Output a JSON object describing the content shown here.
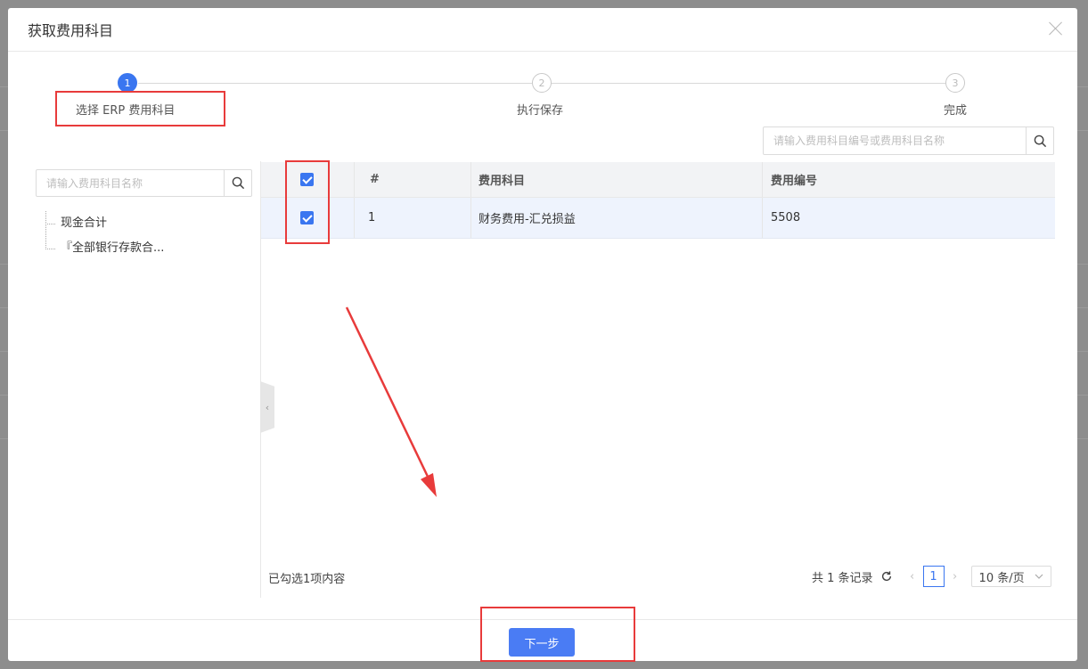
{
  "modal": {
    "title": "获取费用科目"
  },
  "steps": [
    {
      "number": "1",
      "label": "选择 ERP 费用科目",
      "state": "active"
    },
    {
      "number": "2",
      "label": "执行保存",
      "state": "idle"
    },
    {
      "number": "3",
      "label": "完成",
      "state": "idle"
    }
  ],
  "search": {
    "table_placeholder": "请输入费用科目编号或费用科目名称",
    "tree_placeholder": "请输入费用科目名称"
  },
  "tree": {
    "items": [
      "现金合计",
      "『全部银行存款合..."
    ]
  },
  "table": {
    "headers": {
      "index": "#",
      "account": "费用科目",
      "code": "费用编号"
    },
    "rows": [
      {
        "index": "1",
        "account": "财务费用-汇兑损益",
        "code": "5508",
        "checked": true
      }
    ]
  },
  "selection_info": "已勾选1项内容",
  "pagination": {
    "total": "共 1 条记录",
    "current_page": "1",
    "page_size": "10 条/页",
    "prev": "‹",
    "next": "›"
  },
  "footer": {
    "next_label": "下一步"
  },
  "colors": {
    "primary": "#3a76f0",
    "annotation_red": "#e83b3b",
    "row_selected": "#eef3fd"
  }
}
